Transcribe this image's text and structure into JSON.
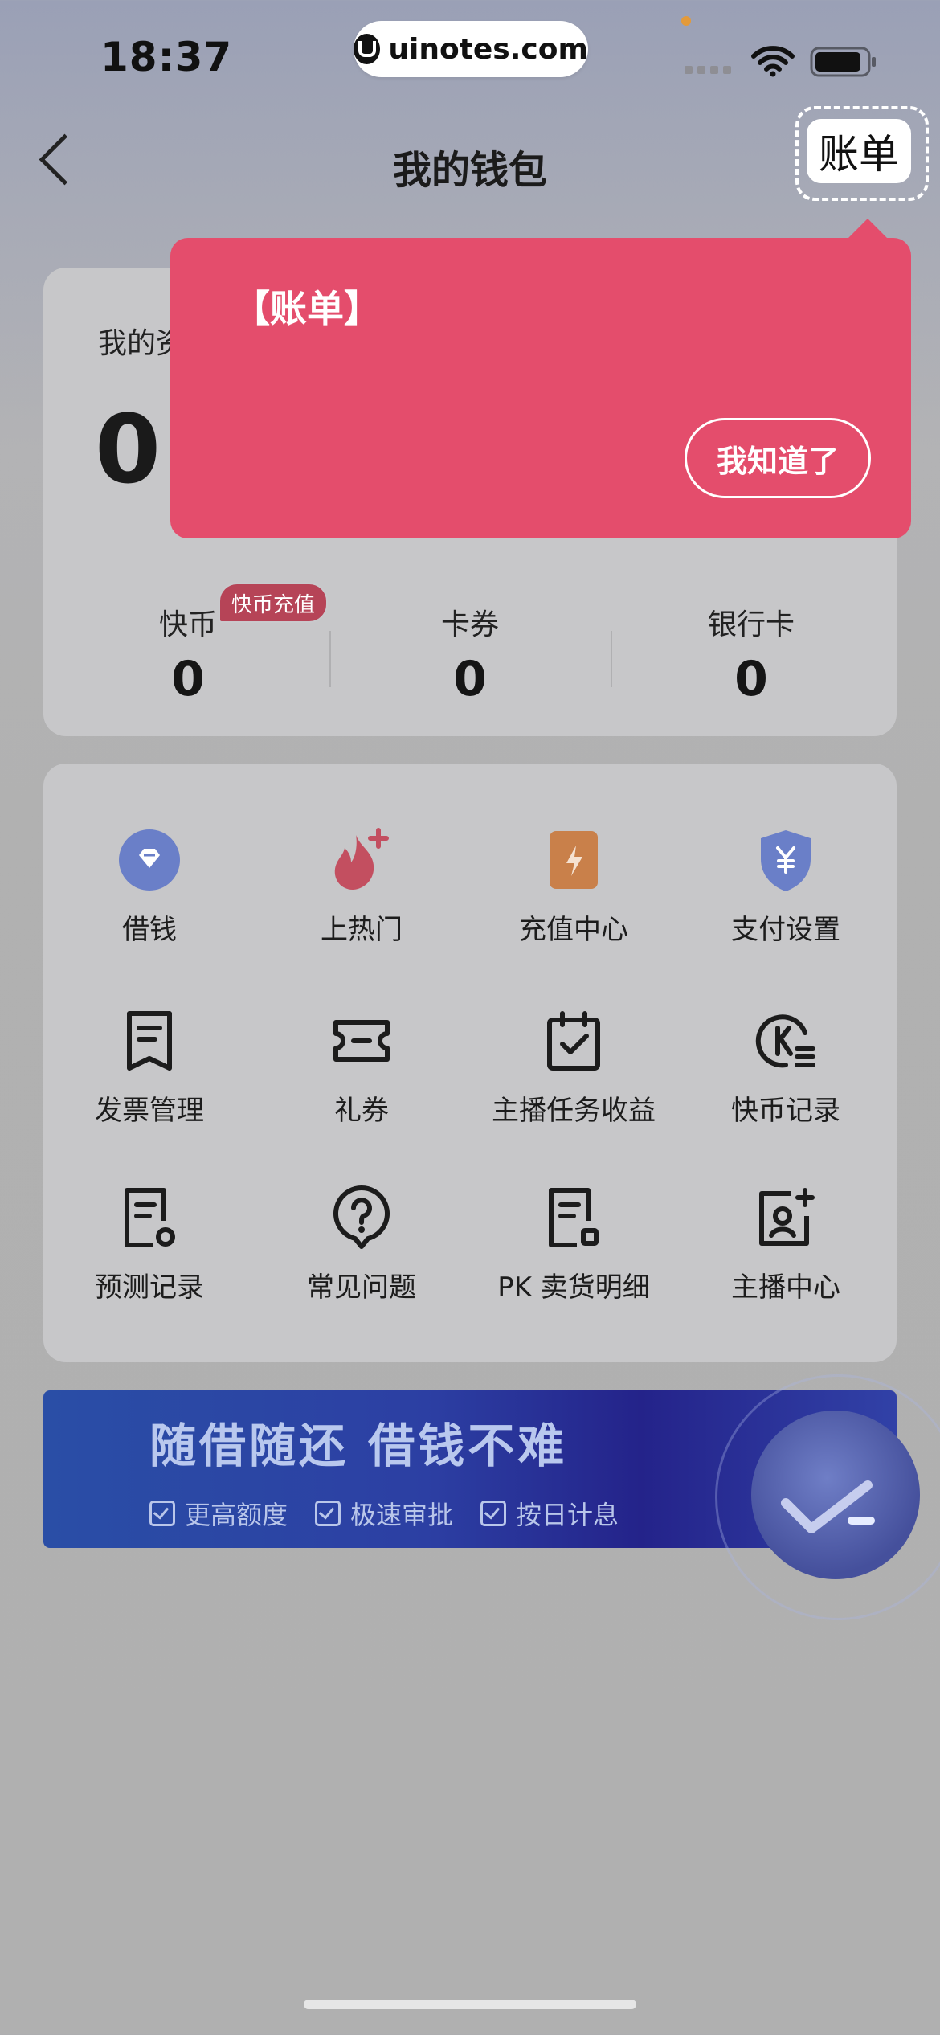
{
  "status_bar": {
    "time": "18:37",
    "watermark": "uinotes.com"
  },
  "nav": {
    "title": "我的钱包",
    "bill_button": "账单"
  },
  "assets": {
    "label": "我的资",
    "amount": "0.",
    "stats": [
      {
        "label": "快币",
        "value": "0"
      },
      {
        "label": "卡券",
        "value": "0"
      },
      {
        "label": "银行卡",
        "value": "0"
      }
    ],
    "badge": "快币充值"
  },
  "grid": {
    "items": [
      {
        "label": "借钱",
        "icon": "borrow-icon"
      },
      {
        "label": "上热门",
        "icon": "flame-icon"
      },
      {
        "label": "充值中心",
        "icon": "recharge-icon"
      },
      {
        "label": "支付设置",
        "icon": "shield-yuan-icon"
      },
      {
        "label": "发票管理",
        "icon": "invoice-icon"
      },
      {
        "label": "礼券",
        "icon": "ticket-icon"
      },
      {
        "label": "主播任务收益",
        "icon": "calendar-check-icon"
      },
      {
        "label": "快币记录",
        "icon": "kcoin-record-icon"
      },
      {
        "label": "预测记录",
        "icon": "prediction-record-icon"
      },
      {
        "label": "常见问题",
        "icon": "question-icon"
      },
      {
        "label": "PK 卖货明细",
        "icon": "pk-detail-icon"
      },
      {
        "label": "主播中心",
        "icon": "anchor-center-icon"
      }
    ]
  },
  "banner": {
    "title": "随借随还  借钱不难",
    "features": [
      "更高额度",
      "极速审批",
      "按日计息"
    ]
  },
  "popup": {
    "title": "【账单】",
    "button": "我知道了"
  },
  "colors": {
    "popup": "#e44d6c",
    "badge": "#b64457",
    "banner": "#2c3fa3"
  }
}
